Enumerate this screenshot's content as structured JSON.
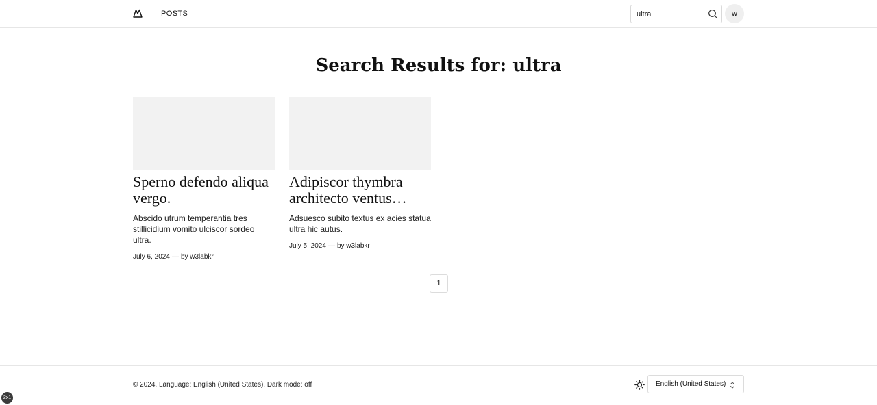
{
  "header": {
    "logo_icon": "mountain-logo-icon",
    "nav_posts": "POSTS",
    "search": {
      "value": "ultra",
      "icon": "search-icon"
    },
    "avatar_initial": "w"
  },
  "main": {
    "title": "Search Results for: ultra",
    "posts": [
      {
        "title": "Sperno defendo aliqua vergo.",
        "excerpt": "Abscido utrum temperantia tres stillicidium vomito ulciscor sordeo ultra.",
        "date": "July 6, 2024",
        "separator": "—",
        "author": "by w3labkr"
      },
      {
        "title": "Adipiscor thymbra architecto ventus…",
        "excerpt": "Adsuesco subito textus ex acies statua ultra hic autus.",
        "date": "July 5, 2024",
        "separator": "—",
        "author": "by w3labkr"
      }
    ],
    "pagination": {
      "current_page": "1"
    }
  },
  "footer": {
    "text": "© 2024. Language: English (United States), Dark mode: off",
    "theme_icon": "sun-icon",
    "language_select": "English (United States)",
    "chevron_icon": "up-down-chevron-icon"
  },
  "zoom_badge": "2x1",
  "colors": {
    "thumbnail_bg": "#f2f2f2",
    "border": "#e6e6e6",
    "text": "#111111"
  }
}
